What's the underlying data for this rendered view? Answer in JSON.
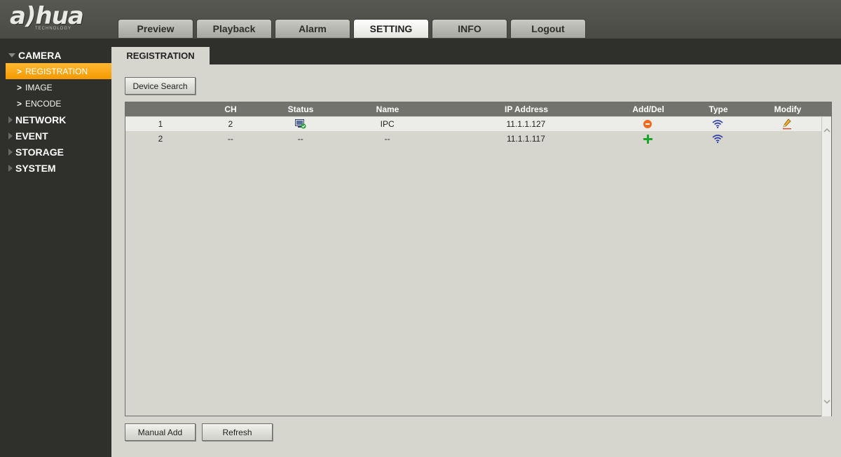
{
  "brand": {
    "name": "a)hua",
    "subtitle": "TECHNOLOGY"
  },
  "nav_tabs": [
    {
      "label": "Preview"
    },
    {
      "label": "Playback"
    },
    {
      "label": "Alarm"
    },
    {
      "label": "SETTING",
      "active": true
    },
    {
      "label": "INFO"
    },
    {
      "label": "Logout"
    }
  ],
  "sidebar": {
    "camera": "CAMERA",
    "items": [
      "REGISTRATION",
      "IMAGE",
      "ENCODE"
    ],
    "groups": [
      "NETWORK",
      "EVENT",
      "STORAGE",
      "SYSTEM"
    ]
  },
  "page": {
    "tab_label": "REGISTRATION",
    "device_search": "Device Search",
    "manual_add": "Manual Add",
    "refresh": "Refresh"
  },
  "table": {
    "columns": [
      "",
      "CH",
      "Status",
      "Name",
      "IP Address",
      "Add/Del",
      "Type",
      "Modify"
    ],
    "rows": [
      {
        "index": "1",
        "ch": "2",
        "status": "online-check-icon",
        "name": "IPC",
        "ip": "11.1.1.127",
        "action": "delete-icon",
        "type": "wifi-icon",
        "modify": "edit-pencil-icon"
      },
      {
        "index": "2",
        "ch": "--",
        "status": "--",
        "name": "--",
        "ip": "11.1.1.117",
        "action": "add-icon",
        "type": "wifi-icon",
        "modify": ""
      }
    ]
  },
  "colors": {
    "accent": "#f59a00",
    "header": "#4a4b45",
    "sidebar": "#2f302b",
    "wifi": "#2f3fa8"
  }
}
